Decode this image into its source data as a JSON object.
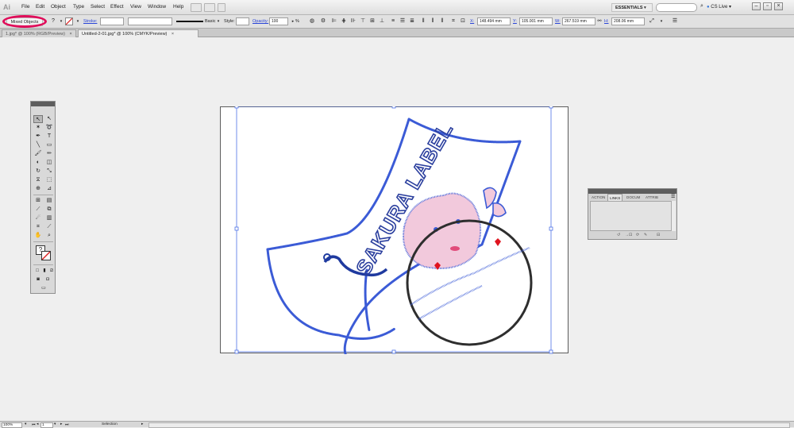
{
  "app": {
    "logo": "Ai"
  },
  "menu": [
    "File",
    "Edit",
    "Object",
    "Type",
    "Select",
    "Effect",
    "View",
    "Window",
    "Help"
  ],
  "workspace": {
    "label": "ESSENTIALS ▾"
  },
  "cs_live": {
    "label": "CS Live ▾"
  },
  "control_bar": {
    "selection_type": "Mixed Objects",
    "stroke_label": "Stroke:",
    "brush_label": "Basic",
    "style_label": "Style:",
    "opacity_label": "Opacity:",
    "opacity_value": "100",
    "opacity_unit": "%",
    "x_label": "X:",
    "x_value": "148.494 mm",
    "y_label": "Y:",
    "y_value": "105.001 mm",
    "w_label": "W:",
    "w_value": "267.519 mm",
    "h_label": "H:",
    "h_value": "208.06 mm"
  },
  "tabs": [
    {
      "label": "1.jpg* @ 100% (RGB/Preview)",
      "active": false
    },
    {
      "label": "Untitled-2-01.jpg* @ 100% (CMYK/Preview)",
      "active": true
    }
  ],
  "artwork": {
    "title_text": "SAKURA LABEL"
  },
  "links_panel": {
    "tabs": [
      "ACTION",
      "LINKS",
      "DOCUM",
      "ATTRIB"
    ],
    "active_tab": "LINKS"
  },
  "status_bar": {
    "zoom": "100%",
    "artboard": "1",
    "tool": "Selection"
  },
  "colors": {
    "selection": "#3b5bd6",
    "highlight": "#e00d5a",
    "pink": "#f2c9dc",
    "heart": "#e0141f"
  }
}
